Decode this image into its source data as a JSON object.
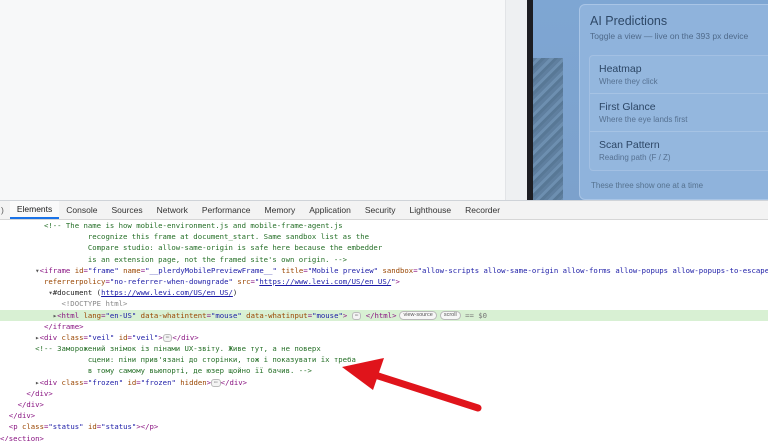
{
  "preview": {
    "panel_title": "AI Predictions",
    "panel_subtitle": "Toggle a view — live on the 393 px device",
    "items": [
      {
        "name": "Heatmap",
        "desc": "Where they click"
      },
      {
        "name": "First Glance",
        "desc": "Where the eye lands first"
      },
      {
        "name": "Scan Pattern",
        "desc": "Reading path (F / Z)"
      }
    ],
    "footer": "These three show one at a time"
  },
  "devtools": {
    "first_tab": ")",
    "tabs": [
      "Elements",
      "Console",
      "Sources",
      "Network",
      "Performance",
      "Memory",
      "Application",
      "Security",
      "Lighthouse",
      "Recorder"
    ],
    "active_tab": "Elements"
  },
  "dom": {
    "c1_l1": "<!-- The name is how mobile-environment.js and mobile-frame-agent.js",
    "c1_l2": "recognize this frame at document_start. Same sandbox list as the",
    "c1_l3": "Compare studio: allow-same-origin is safe here because the embedder",
    "c1_l4": "is an extension page, not the framed site's own origin. -->",
    "iframe_tag": "iframe",
    "iframe_id": "frame",
    "iframe_name": "__plerdyMobilePreviewFrame__",
    "iframe_title": "Mobile preview",
    "iframe_sandbox": "allow-scripts allow-same-origin allow-forms allow-popups allow-popups-to-escape-sa",
    "iframe_referrer": "no-referrer-when-downgrade",
    "iframe_src": "https://www.levi.com/US/en_US/",
    "document_label": "#document",
    "document_url": "https://www.levi.com/US/en_US/",
    "doctype": "<!DOCTYPE html>",
    "html_lang": "en-US",
    "html_intent": "mouse",
    "html_input": "mouse",
    "badge_view_source": "view-source",
    "badge_scroll": "scroll",
    "selected_marker": "== $0",
    "veil_class": "veil",
    "veil_id": "veil",
    "c2_l1": "<!-- Заморожений знімок із пінами UX-звіту. Живе тут, а не поверх",
    "c2_l2": "сцени: піни прив'язані до сторінки, тож і показувати їх треба",
    "c2_l3": "в тому самому вьюпорті, де юзер щойно її бачив. -->",
    "frozen_class": "frozen",
    "frozen_id": "frozen",
    "status_class": "status",
    "status_id": "status"
  },
  "annotation": {
    "arrow_color": "#e0141b"
  }
}
